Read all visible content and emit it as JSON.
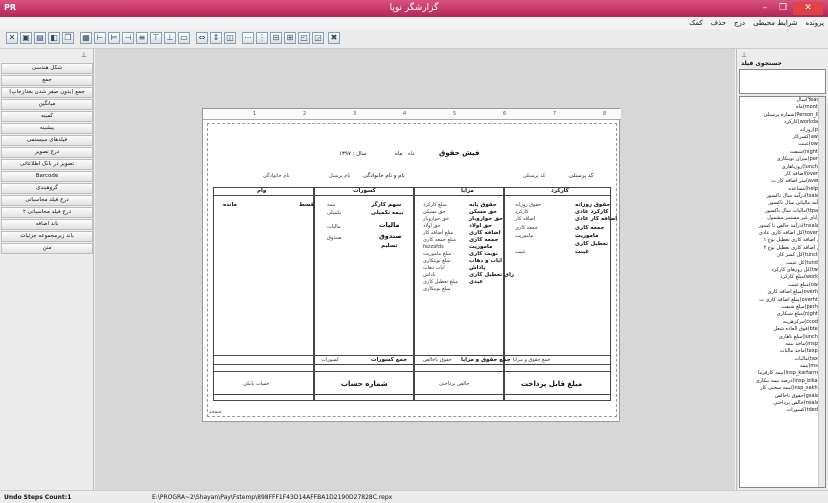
{
  "window": {
    "app_mark": "PR",
    "title": "گزارشگر نوپا"
  },
  "menu": [
    "پرونده",
    "شرایط محیطی",
    "درج",
    "حذف",
    "کمک"
  ],
  "toolbar_icons": [
    "x-icon",
    "properties-icon",
    "save-icon",
    "open-icon",
    "copy-icon",
    "grid-icon",
    "align-left-icon",
    "align-center-icon",
    "align-right-icon",
    "align-justify-icon",
    "align-top-icon",
    "align-middle-icon",
    "align-bottom-icon",
    "same-width-icon",
    "same-height-icon",
    "same-size-icon",
    "space-h-icon",
    "space-v-icon",
    "center-h-icon",
    "center-v-icon",
    "bring-front-icon",
    "send-back-icon",
    "x-delete-icon"
  ],
  "left_panel": {
    "buttons": [
      "شکل هندسی",
      "جمع",
      "جمع (بدون صفر شدن بعدازجاپ)",
      "میانگین",
      "کمینه",
      "بیشینه",
      "فیلدهای سیستمی",
      "درج تصویر",
      "تصویر در بانک اطلاعاتی",
      "Barcode",
      "گروهبندی",
      "درج فیلد محاسباتی",
      "درج فیلد محاسباتی ۲",
      "باند اضافه",
      "باند زیرمجموعه جزئیات",
      "متن"
    ]
  },
  "report": {
    "ruler": [
      "1",
      "2",
      "3",
      "4",
      "5",
      "6",
      "7",
      "8"
    ],
    "header_title": "فیش حقوق",
    "month_label": "ماه",
    "month_field": "ماه",
    "year_label": "سال : ۱۳۹۷",
    "employee_code_label": "کد پرسنلی",
    "employee_code_field": "کد پرسنلی",
    "name_label": "نام و نام خانوادگی",
    "name_field": "نام پرسنل",
    "family_field": "نام خانوادگی",
    "columns": {
      "work": "کارکرد",
      "benefits": "مزایا",
      "deductions": "کسورات",
      "loan": "وام"
    },
    "work_items": [
      "حقوق روزانه",
      "کارکرد عادی",
      "اضافه کار عادی",
      "جمعه کاری",
      "ماموریت",
      "تعطیل کاری",
      "غیبت"
    ],
    "work_fields": [
      "حقوق روزانه",
      "کارکرد",
      "اضافه کار",
      "جمعه کاری",
      "ماموریت",
      "غیبت"
    ],
    "benefit_items": [
      "حقوق پایه",
      "حق مسکن",
      "حق خواروبار",
      "حق اولاد",
      "اضافه کاری",
      "جمعه کاری",
      "ماموریت",
      "نوبت کاری",
      "ایاب و ذهاب",
      "پاداش",
      "رای تعطیل کاری",
      "عیدی"
    ],
    "benefit_fields": [
      "مبلغ کارکرد",
      "حق مسکن",
      "حق خواروبار",
      "حق اولاد",
      "مبلغ اضافه کار",
      "مبلغ جمعه کاری",
      "fazzafds",
      "مبلغ ماموریت",
      "مبلغ نوبتکاری",
      "ایاب ذهاب",
      "پاداش",
      "مبلغ تعطیل کاری",
      "مبلغ نوبتکاری"
    ],
    "deduction_items": [
      "سهم کارگر",
      "بیمه تکمیلی",
      "مالیات",
      "صندوق",
      "تسلیم"
    ],
    "deduction_fields": [
      "بیمه",
      "تکمیلی",
      "مالیات",
      "صندوق"
    ],
    "loan_items": [
      "مانده",
      "قسط"
    ],
    "total_work_field": "جمع حقوق و مزایا",
    "total_benefits_label": "جمع حقوق و مزایا",
    "total_benefits_field": "حقوق ناخالص",
    "total_deductions_label": "جمع کسورات",
    "total_deductions_field": "کسورات",
    "payable_label": "مبلغ قابل پرداخت",
    "payable_field": "خالص پرداختی",
    "account_label": "شماره حساب",
    "account_field": "حساب بانکی",
    "footer_band": "صفحه"
  },
  "right_panel": {
    "label": "جستجوی فیلد",
    "search_value": "",
    "fields": [
      "سال(Years)",
      "ماه(month)",
      "شماره پرسنلی(Person_ID)",
      "کارکرد(workday)",
      "روزانه(pd)",
      "کسرکار(awh)",
      "غیبت(owh)",
      "شیفت(nighth)",
      "میزان نوبتکاری(perh)",
      "روزناهاری(lunchd)",
      "اضافه کار(overh)",
      "سر اضافه کار ت(avert)",
      "مساعده(helpa)",
      "درآمد سال ناکسور(tsalar)",
      "درآمد مالیاتی سال ناکسور",
      "مالیات سال ناکسور(ttpay)",
      "مزایای غیر مستمر مشمول",
      "درآمد خالص تا کسور(tnsalar)",
      "کل اضافه کاری عادی(toverh)",
      "کل اضافه کاری تعطیل نوع ۱",
      "کل اضافه کاری تعطیل نوع ۲",
      "کل کسر کار(tunct1)",
      "کل غیبت(tund2)",
      "کل روزهای کارکرد(twd)",
      "مبلغ کارکرد(worka)",
      "مبلغ غیبت(owp)",
      "مبلغ اضافه کاری(overhp)",
      "مبلغ اضافه کاری ت(overhtp)",
      "مبلغ شیفت(perhp)",
      "مبلغ شبکاری(nightp)",
      "مرکزهزینه(ccode)",
      "فوق العاده شغل(btep)",
      "مبلغ ناهاری(lunchp)",
      "ماخذ بیمه(msp1)",
      "ماخذ مالیات(taxp1)",
      "مالیات(taxp)",
      "بیمه(msp)",
      "بیمه کارفرما(insp_karfarma)",
      "درصد بیمه بیکاری(insp_bikari)",
      "بیمه سختی کار(insp_sakhti)",
      "حقوق ناخالص(gsalar)",
      "خالص پرداختی(nsalar)",
      "کسورات(tdedu)"
    ]
  },
  "status": {
    "undo": "Undo Steps Count:1",
    "path": "E:\\PROGRA~2\\Shayan\\Pay\\Fstemp\\898FFF1F43D14AFFBA1D2190D27828C.repx"
  }
}
